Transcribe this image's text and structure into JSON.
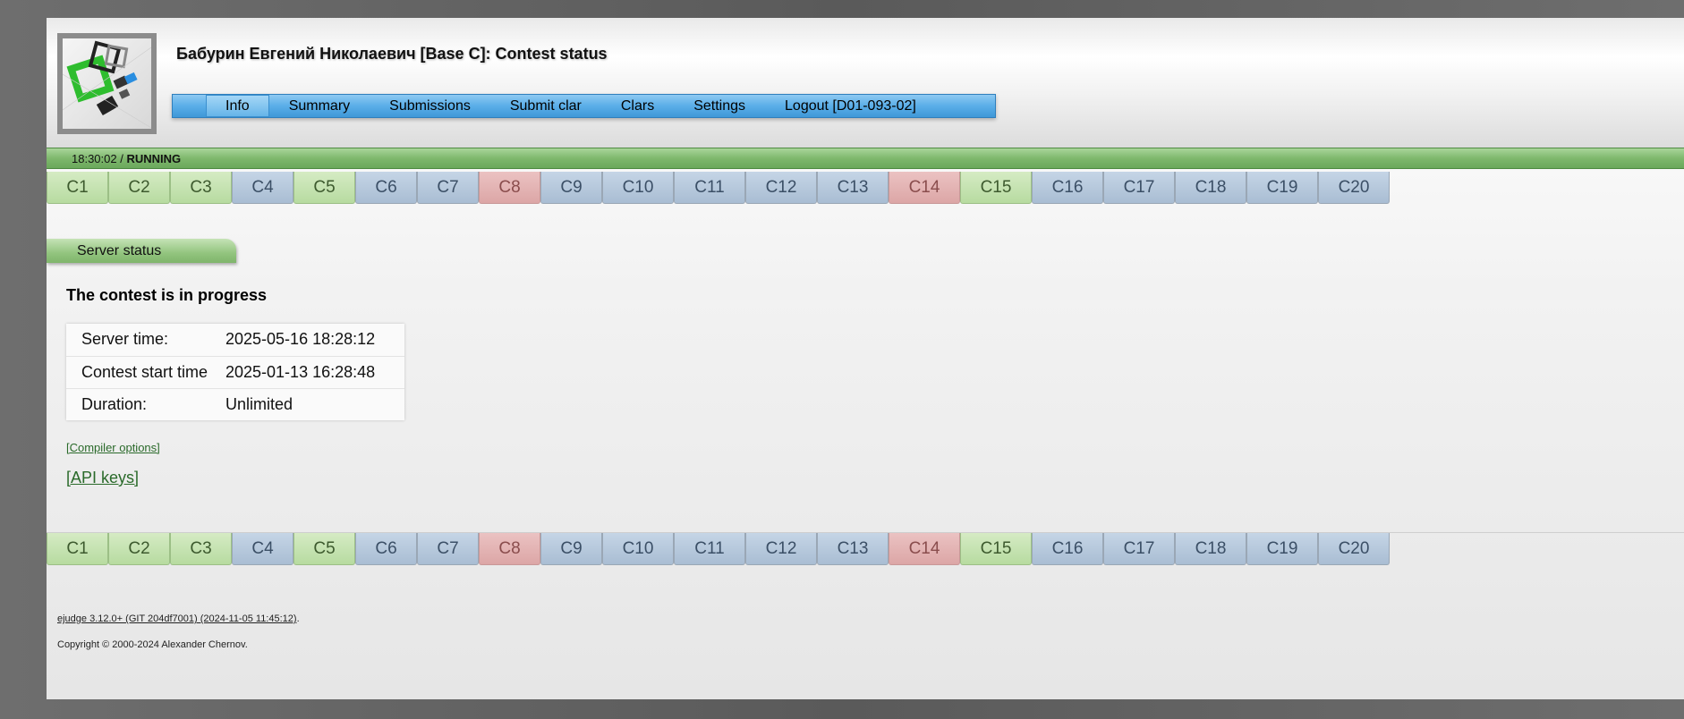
{
  "header": {
    "title": "Бабурин Евгений Николаевич [Base C]: Contest status",
    "menu": [
      {
        "label": "Info",
        "active": true
      },
      {
        "label": "Summary",
        "active": false
      },
      {
        "label": "Submissions",
        "active": false
      },
      {
        "label": "Submit clar",
        "active": false
      },
      {
        "label": "Clars",
        "active": false
      },
      {
        "label": "Settings",
        "active": false
      },
      {
        "label": "Logout [D01-093-02]",
        "active": false
      }
    ]
  },
  "status": {
    "time": "18:30:02",
    "separator": " / ",
    "state": "RUNNING"
  },
  "problems": [
    {
      "label": "C1",
      "status": "green"
    },
    {
      "label": "C2",
      "status": "green"
    },
    {
      "label": "C3",
      "status": "green"
    },
    {
      "label": "C4",
      "status": "blue"
    },
    {
      "label": "C5",
      "status": "green"
    },
    {
      "label": "C6",
      "status": "blue"
    },
    {
      "label": "C7",
      "status": "blue"
    },
    {
      "label": "C8",
      "status": "red"
    },
    {
      "label": "C9",
      "status": "blue"
    },
    {
      "label": "C10",
      "status": "blue"
    },
    {
      "label": "C11",
      "status": "blue"
    },
    {
      "label": "C12",
      "status": "blue"
    },
    {
      "label": "C13",
      "status": "blue"
    },
    {
      "label": "C14",
      "status": "red"
    },
    {
      "label": "C15",
      "status": "green"
    },
    {
      "label": "C16",
      "status": "blue"
    },
    {
      "label": "C17",
      "status": "blue"
    },
    {
      "label": "C18",
      "status": "blue"
    },
    {
      "label": "C19",
      "status": "blue"
    },
    {
      "label": "C20",
      "status": "blue"
    }
  ],
  "section": {
    "title": "Server status",
    "message": "The contest is in progress"
  },
  "info_rows": [
    {
      "key": "Server time:",
      "value": "2025-05-16 18:28:12"
    },
    {
      "key": "Contest start time",
      "value": "2025-01-13 16:28:48"
    },
    {
      "key": "Duration:",
      "value": "Unlimited"
    }
  ],
  "links": {
    "compiler_options": "[Compiler options]",
    "api_keys": "[API keys]"
  },
  "footer": {
    "version_link": "ejudge 3.12.0+ (GIT 204df7001) (2024-11-05 11:45:12)",
    "version_suffix": ".",
    "copyright": "Copyright © 2000-2024 Alexander Chernov."
  },
  "colors": {
    "menu_blue": "#5aaee8",
    "status_green": "#7fb86d",
    "problem_blue": "#b5c8dc",
    "problem_green": "#c6e3b2",
    "problem_red": "#e3b3b3",
    "link_green": "#2a6a2a"
  }
}
